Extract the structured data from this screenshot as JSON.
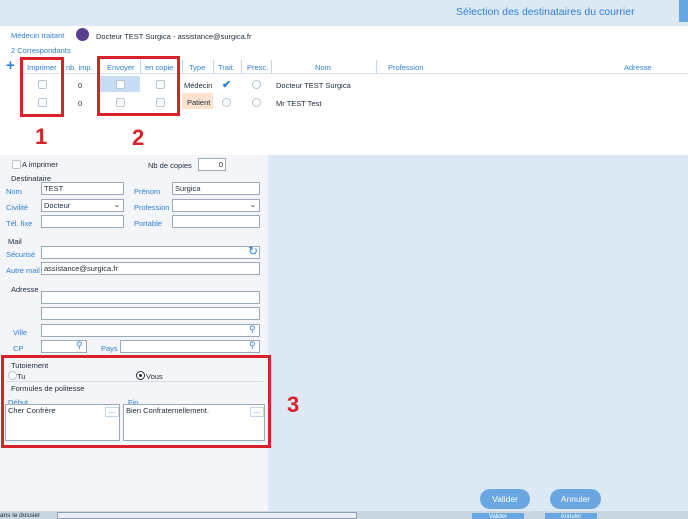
{
  "title": "Sélection des destinataires du courrier",
  "medecin": {
    "label": "Médecin traitant",
    "value": "Docteur TEST Surgica",
    "email": "- assistance@surgica.fr"
  },
  "correspondants": "2 Correspondants",
  "columns": [
    "Imprimer",
    "nb. imp.",
    "Envoyer",
    "en copie",
    "Type",
    "Trait.",
    "Presc.",
    "Nom",
    "Profession",
    "Adresse"
  ],
  "rows": [
    {
      "nb": "0",
      "type": "Médecin",
      "nom": "Docteur TEST Surgica"
    },
    {
      "nb": "0",
      "type": "Patient",
      "nom": "Mr TEST Test"
    }
  ],
  "form": {
    "a_imprimer": "A imprimer",
    "nb_copies_label": "Nb de copies",
    "nb_copies": "0",
    "destinataire": "Destinataire",
    "nom_label": "Nom",
    "nom": "TEST",
    "prenom_label": "Prénom",
    "prenom": "Surgica",
    "civilite_label": "Civilité",
    "civilite": "Docteur",
    "profession_label": "Profession",
    "profession": "",
    "tel_label": "Tél. fixe",
    "portable_label": "Portable",
    "mail": "Mail",
    "securise_label": "Sécurisé",
    "autre_mail_label": "Autre mail",
    "autre_mail": "assistance@surgica.fr",
    "adresse": "Adresse",
    "ville_label": "Ville",
    "cp_label": "CP",
    "pays_label": "Pays",
    "tutoiement": "Tutoiement",
    "tu": "Tu",
    "vous": "Vous",
    "formules": "Formules de politesse",
    "debut_label": "Début",
    "debut": "Cher Confrère",
    "fin_label": "Fin",
    "fin": "Bien Confraternellement."
  },
  "buttons": {
    "valider": "Valider",
    "annuler": "Annuler"
  },
  "bottom": {
    "left": "ans le dossier",
    "valider": "Valider",
    "annuler": "Annuler"
  },
  "annotations": [
    "1",
    "2",
    "3"
  ],
  "colors": {
    "accent": "#2f7fd0",
    "annotation": "#d9212a",
    "button": "#6aa7e0"
  }
}
